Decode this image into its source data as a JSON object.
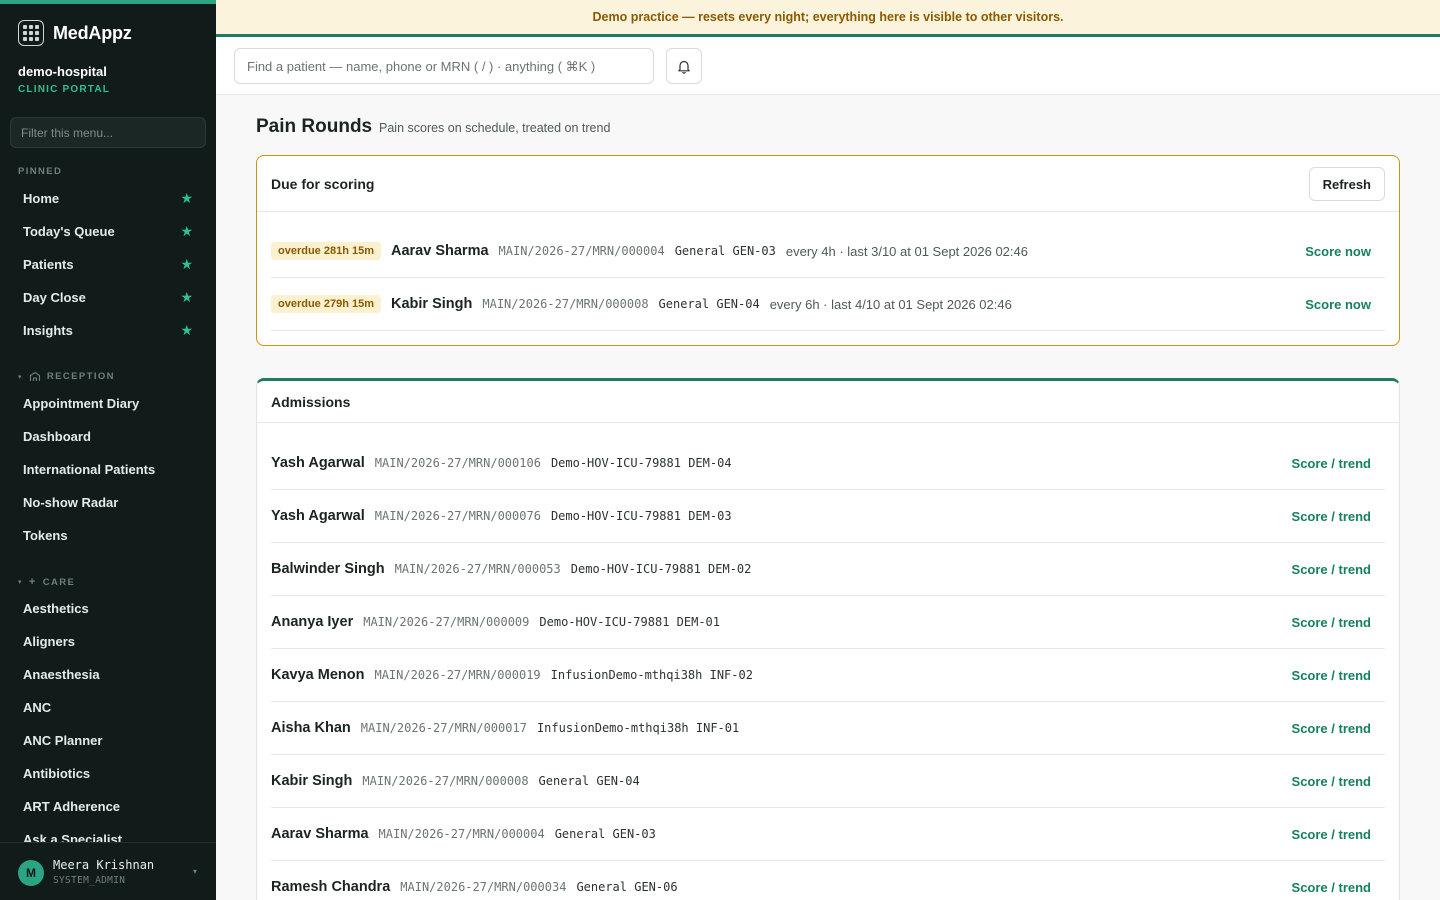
{
  "brand": {
    "name": "MedAppz"
  },
  "tenant": {
    "name": "demo-hospital",
    "portal": "CLINIC PORTAL"
  },
  "sidebar": {
    "filter_placeholder": "Filter this menu...",
    "pinned_label": "PINNED",
    "pinned": [
      {
        "label": "Home"
      },
      {
        "label": "Today's Queue"
      },
      {
        "label": "Patients"
      },
      {
        "label": "Day Close"
      },
      {
        "label": "Insights"
      }
    ],
    "reception_label": "RECEPTION",
    "reception": [
      {
        "label": "Appointment Diary"
      },
      {
        "label": "Dashboard"
      },
      {
        "label": "International Patients"
      },
      {
        "label": "No-show Radar"
      },
      {
        "label": "Tokens"
      }
    ],
    "care_label": "CARE",
    "care": [
      {
        "label": "Aesthetics"
      },
      {
        "label": "Aligners"
      },
      {
        "label": "Anaesthesia"
      },
      {
        "label": "ANC"
      },
      {
        "label": "ANC Planner"
      },
      {
        "label": "Antibiotics"
      },
      {
        "label": "ART Adherence"
      },
      {
        "label": "Ask a Specialist"
      }
    ]
  },
  "user": {
    "initial": "M",
    "name": "Meera Krishnan",
    "role": "SYSTEM_ADMIN"
  },
  "banner": {
    "text": "Demo practice — resets every night; everything here is visible to other visitors."
  },
  "search": {
    "placeholder": "Find a patient — name, phone or MRN ( / ) · anything ( ⌘K )"
  },
  "page": {
    "title": "Pain Rounds",
    "subtitle": "Pain scores on schedule, treated on trend"
  },
  "due": {
    "title": "Due for scoring",
    "refresh_label": "Refresh",
    "rows": [
      {
        "badge": "overdue 281h 15m",
        "name": "Aarav Sharma",
        "mrn": "MAIN/2026-27/MRN/000004",
        "bed": "General GEN-03",
        "schedule": "every 4h · last 3/10 at 01 Sept 2026 02:46",
        "action": "Score now"
      },
      {
        "badge": "overdue 279h 15m",
        "name": "Kabir Singh",
        "mrn": "MAIN/2026-27/MRN/000008",
        "bed": "General GEN-04",
        "schedule": "every 6h · last 4/10 at 01 Sept 2026 02:46",
        "action": "Score now"
      }
    ]
  },
  "admissions": {
    "title": "Admissions",
    "rows": [
      {
        "name": "Yash Agarwal",
        "mrn": "MAIN/2026-27/MRN/000106",
        "bed": "Demo-HOV-ICU-79881 DEM-04",
        "action": "Score / trend"
      },
      {
        "name": "Yash Agarwal",
        "mrn": "MAIN/2026-27/MRN/000076",
        "bed": "Demo-HOV-ICU-79881 DEM-03",
        "action": "Score / trend"
      },
      {
        "name": "Balwinder Singh",
        "mrn": "MAIN/2026-27/MRN/000053",
        "bed": "Demo-HOV-ICU-79881 DEM-02",
        "action": "Score / trend"
      },
      {
        "name": "Ananya Iyer",
        "mrn": "MAIN/2026-27/MRN/000009",
        "bed": "Demo-HOV-ICU-79881 DEM-01",
        "action": "Score / trend"
      },
      {
        "name": "Kavya Menon",
        "mrn": "MAIN/2026-27/MRN/000019",
        "bed": "InfusionDemo-mthqi38h INF-02",
        "action": "Score / trend"
      },
      {
        "name": "Aisha Khan",
        "mrn": "MAIN/2026-27/MRN/000017",
        "bed": "InfusionDemo-mthqi38h INF-01",
        "action": "Score / trend"
      },
      {
        "name": "Kabir Singh",
        "mrn": "MAIN/2026-27/MRN/000008",
        "bed": "General GEN-04",
        "action": "Score / trend"
      },
      {
        "name": "Aarav Sharma",
        "mrn": "MAIN/2026-27/MRN/000004",
        "bed": "General GEN-03",
        "action": "Score / trend"
      },
      {
        "name": "Ramesh Chandra",
        "mrn": "MAIN/2026-27/MRN/000034",
        "bed": "General GEN-06",
        "action": "Score / trend"
      }
    ]
  },
  "colors": {
    "accent": "#2aa583",
    "sidebar_bg": "#111c1a",
    "warning": "#c8960c",
    "link": "#17805f"
  },
  "icons": {
    "logo": "grid-logo-icon",
    "bell": "bell-icon",
    "star": "star-icon",
    "reception": "building-icon",
    "care": "plus-icon"
  }
}
